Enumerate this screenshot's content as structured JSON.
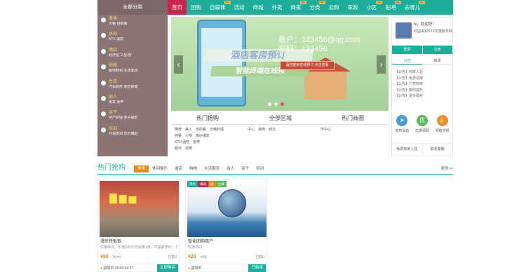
{
  "nav": {
    "all_categories": "全部分类",
    "items": [
      {
        "label": "首页",
        "active": true,
        "hot": false
      },
      {
        "label": "团购",
        "active": false,
        "hot": false
      },
      {
        "label": "自媒体",
        "active": false,
        "hot": true
      },
      {
        "label": "活动",
        "active": false,
        "hot": false
      },
      {
        "label": "商城",
        "active": false,
        "hot": false
      },
      {
        "label": "外卖",
        "active": false,
        "hot": false
      },
      {
        "label": "商家",
        "active": false,
        "hot": true
      },
      {
        "label": "分类",
        "active": false,
        "hot": true
      },
      {
        "label": "云购",
        "active": false,
        "hot": false
      },
      {
        "label": "家政",
        "active": false,
        "hot": false
      },
      {
        "label": "小区",
        "active": false,
        "hot": true
      },
      {
        "label": "贴吧",
        "active": false,
        "hot": true
      },
      {
        "label": "去哪儿",
        "active": false,
        "hot": true
      }
    ],
    "hot_badge": "hot"
  },
  "categories": [
    {
      "title": "美食",
      "sub": "大餐  自助餐",
      "icon": "food-icon"
    },
    {
      "title": "休闲",
      "sub": "KTV  温泉",
      "icon": "leisure-icon"
    },
    {
      "title": "酒店",
      "sub": "经济型  三星/舒",
      "icon": "hotel-icon"
    },
    {
      "title": "购物",
      "sub": "服饰鞋包  生活家居",
      "icon": "shopping-icon"
    },
    {
      "title": "生活",
      "sub": "汽车服务  体检保健",
      "icon": "life-icon"
    },
    {
      "title": "丽人",
      "sub": "美发  美甲",
      "icon": "beauty-icon"
    },
    {
      "title": "亲子",
      "sub": "孕产护理  亲子摄影",
      "icon": "parent-child-icon"
    },
    {
      "title": "培训",
      "sub": "外语培训  音乐舞蹈",
      "icon": "training-icon"
    }
  ],
  "banner": {
    "account_line": "账户：123456@qq.com",
    "password_line": "密码：123456",
    "sign_text": "酒店客房预订",
    "sign_text2": "智能终端在线预",
    "button_text": "酒店客房在线预订 点击查看",
    "prev": "‹",
    "next": "›"
  },
  "tabs": [
    {
      "title": "热门抢购",
      "items": [
        "推荐",
        "美人",
        "自助餐",
        "日韩料理",
        "西餐",
        "火锅",
        "婚纱摄影",
        "KTV/酒吧",
        "鱼类",
        "甜点",
        "烧烤"
      ]
    },
    {
      "title": "全部区域",
      "items": [
        "中心",
        "城南",
        "城北"
      ]
    },
    {
      "title": "热门商圈",
      "items": [
        "市中心"
      ]
    }
  ],
  "user": {
    "hi": "hi，欢迎您！",
    "welcome": "欢迎来到XXX优惠服务网",
    "login": "登录",
    "register": "注册",
    "notice_tabs": [
      "公告",
      "新闻"
    ],
    "notices": [
      "【公告】商家入驻",
      "【公告】免费试用",
      "【公告】广告商家",
      "【公告】帮你提升",
      "【公告】更多报名"
    ],
    "quick": [
      {
        "label": "发布消息",
        "color": "#4a9ad8",
        "glyph": "➤",
        "icon": "send-icon"
      },
      {
        "label": "优惠领取",
        "color": "#5cb85c",
        "glyph": "优",
        "icon": "coupon-icon"
      },
      {
        "label": "领取手机",
        "color": "#f0883e",
        "glyph": "✋",
        "icon": "hand-icon"
      }
    ],
    "links": [
      "免费商家入驻",
      "联系客服"
    ]
  },
  "hot": {
    "title": "热门抢购",
    "tabs": [
      "美食",
      "休闲娱乐",
      "酒店",
      "购物",
      "生活服务",
      "丽人",
      "亲子",
      "培训"
    ],
    "more": "更多>>"
  },
  "cards": [
    {
      "title": "漫步铁板饭",
      "desc": "优惠45元，价值100元代金券1张，可提前预约，下单",
      "price": "¥90",
      "orig": "¥144",
      "sold": "已售0",
      "loc": "邵阳市",
      "time": "20:03:53:37",
      "btn": "立即购买",
      "badges": []
    },
    {
      "title": "智化团购商户",
      "desc": "优惠1块1",
      "price": "¥20",
      "orig": "¥33",
      "sold": "已售0",
      "loc": "邵阳市",
      "time": "",
      "btn": "已结束",
      "badges": [
        {
          "t": "预约",
          "c": "#1cae9b"
        },
        {
          "t": "满减",
          "c": "#c7254e"
        },
        {
          "t": "减",
          "c": "#e8891e"
        },
        {
          "t": "立减",
          "c": "#5cb85c"
        }
      ]
    }
  ]
}
